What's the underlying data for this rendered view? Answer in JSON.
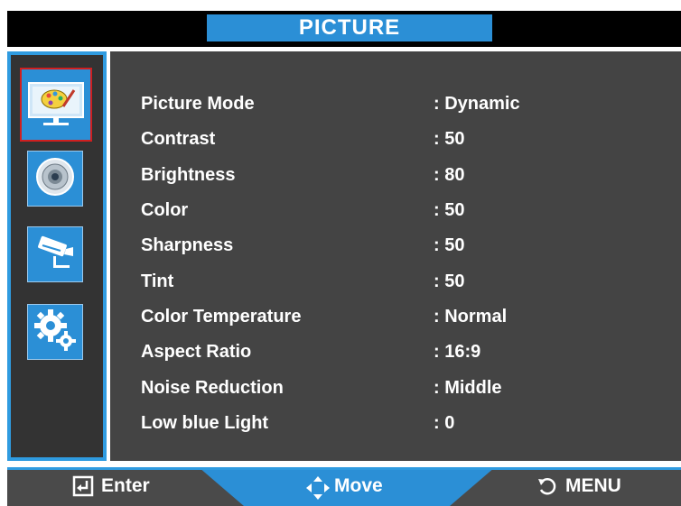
{
  "header": {
    "title": "PICTURE"
  },
  "sidebar": {
    "items": [
      {
        "icon": "picture-icon",
        "active": true
      },
      {
        "icon": "sound-icon",
        "active": false
      },
      {
        "icon": "camera-icon",
        "active": false
      },
      {
        "icon": "settings-gears-icon",
        "active": false
      }
    ]
  },
  "menu": {
    "items": [
      {
        "label": "Picture Mode",
        "value": ": Dynamic"
      },
      {
        "label": "Contrast",
        "value": ": 50"
      },
      {
        "label": "Brightness",
        "value": ": 80"
      },
      {
        "label": "Color",
        "value": ": 50"
      },
      {
        "label": "Sharpness",
        "value": ": 50"
      },
      {
        "label": "Tint",
        "value": ": 50"
      },
      {
        "label": "Color Temperature",
        "value": ": Normal"
      },
      {
        "label": "Aspect Ratio",
        "value": ": 16:9"
      },
      {
        "label": "Noise Reduction",
        "value": ": Middle"
      },
      {
        "label": "Low blue Light",
        "value": ": 0"
      }
    ]
  },
  "footer": {
    "enter_label": "Enter",
    "move_label": "Move",
    "menu_label": "MENU"
  },
  "colors": {
    "accent": "#2b8fd6",
    "panel": "#444444",
    "sidebar": "#333333",
    "active_border": "#d11f1f"
  }
}
